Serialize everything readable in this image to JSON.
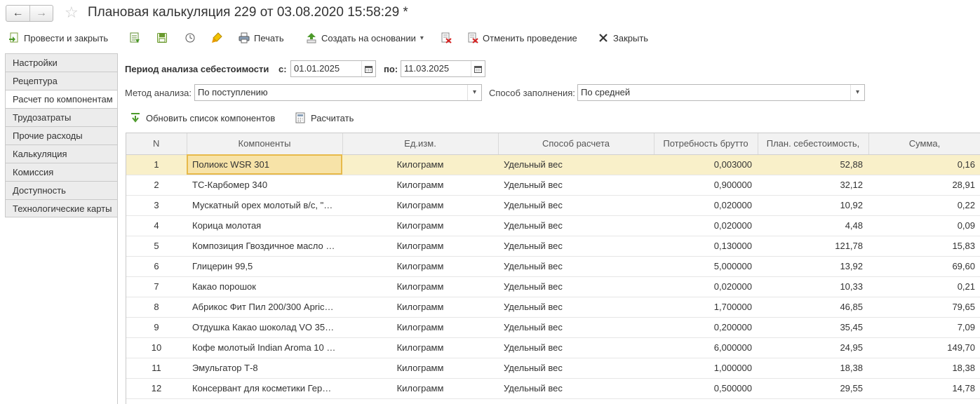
{
  "window": {
    "title": "Плановая калькуляция 229 от 03.08.2020 15:58:29 *",
    "back_label": "←",
    "forward_label": "→",
    "favorite_label": "☆"
  },
  "toolbar": {
    "post_close": "Провести и закрыть",
    "print": "Печать",
    "create_based": "Создать на основании",
    "create_based_arrow": "▾",
    "cancel_posting": "Отменить проведение",
    "close": "Закрыть"
  },
  "sidebar": {
    "items": [
      {
        "label": "Настройки"
      },
      {
        "label": "Рецептура"
      },
      {
        "label": "Расчет по компонентам"
      },
      {
        "label": "Трудозатраты"
      },
      {
        "label": "Прочие расходы"
      },
      {
        "label": "Калькуляция"
      },
      {
        "label": "Комиссия"
      },
      {
        "label": "Доступность"
      },
      {
        "label": "Технологические карты"
      }
    ],
    "active_index": 2
  },
  "form": {
    "period_label": "Период анализа себестоимости",
    "from_label": "с:",
    "from_value": "01.01.2025",
    "to_label": "по:",
    "to_value": "11.03.2025",
    "method_label": "Метод анализа:",
    "method_value": "По поступлению",
    "fill_label": "Способ заполнения:",
    "fill_value": "По средней",
    "refresh_label": "Обновить список компонентов",
    "calc_label": "Расчитать"
  },
  "table": {
    "headers": [
      "N",
      "Компоненты",
      "Ед.изм.",
      "Способ расчета",
      "Потребность брутто",
      "План. себестоимость,",
      "Сумма,"
    ],
    "rows": [
      [
        "1",
        "Полиокс WSR 301",
        "Килограмм",
        "Удельный вес",
        "0,003000",
        "52,88",
        "0,16"
      ],
      [
        "2",
        "ТС-Карбомер 340",
        "Килограмм",
        "Удельный вес",
        "0,900000",
        "32,12",
        "28,91"
      ],
      [
        "3",
        "Мускатный орех молотый в/с, \"…",
        "Килограмм",
        "Удельный вес",
        "0,020000",
        "10,92",
        "0,22"
      ],
      [
        "4",
        "Корица молотая",
        "Килограмм",
        "Удельный вес",
        "0,020000",
        "4,48",
        "0,09"
      ],
      [
        "5",
        "Композиция Гвоздичное масло …",
        "Килограмм",
        "Удельный вес",
        "0,130000",
        "121,78",
        "15,83"
      ],
      [
        "6",
        "Глицерин 99,5",
        "Килограмм",
        "Удельный вес",
        "5,000000",
        "13,92",
        "69,60"
      ],
      [
        "7",
        "Какао порошок",
        "Килограмм",
        "Удельный вес",
        "0,020000",
        "10,33",
        "0,21"
      ],
      [
        "8",
        "Абрикос Фит Пил 200/300 Apric…",
        "Килограмм",
        "Удельный вес",
        "1,700000",
        "46,85",
        "79,65"
      ],
      [
        "9",
        "Отдушка Какао шоколад VO 35…",
        "Килограмм",
        "Удельный вес",
        "0,200000",
        "35,45",
        "7,09"
      ],
      [
        "10",
        "Кофе молотый Indian Aroma 10 …",
        "Килограмм",
        "Удельный вес",
        "6,000000",
        "24,95",
        "149,70"
      ],
      [
        "11",
        "Эмульгатор Т-8",
        "Килограмм",
        "Удельный вес",
        "1,000000",
        "18,38",
        "18,38"
      ],
      [
        "12",
        "Консервант для косметики Гер…",
        "Килограмм",
        "Удельный вес",
        "0,500000",
        "29,55",
        "14,78"
      ]
    ],
    "selected_row": 0
  },
  "icons": {
    "calendar": "calendar-icon",
    "dropdown": "chevron-down-icon"
  }
}
